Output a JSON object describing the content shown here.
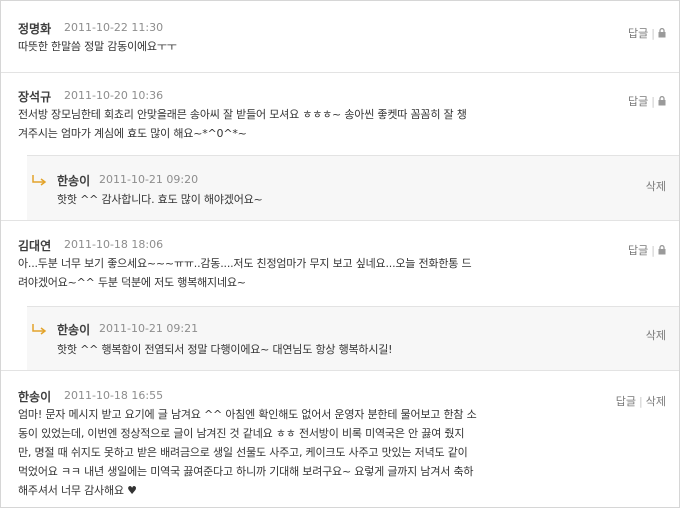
{
  "comments": [
    {
      "author": "정명화",
      "date": "2011-10-22 11:30",
      "lines": [
        "따뜻한 한말씀 정말 감동이에요ㅜㅜ"
      ],
      "actions": [
        "답글"
      ],
      "icon": "lock-icon"
    },
    {
      "author": "장석규",
      "date": "2011-10-20 10:36",
      "lines": [
        "전서방 장모님한테 회쵸리 안맞을래믄 송아씨 잘 받들어 모셔요 ㅎㅎㅎ~ 송아씬 좋켓따 꼼꼼히 잘 챙",
        "겨주시는 엄마가 계심에 효도 많이 해요~*^0^*~"
      ],
      "actions": [
        "답글"
      ],
      "icon": "lock-icon",
      "reply": {
        "author": "한송이",
        "date": "2011-10-21 09:20",
        "lines": [
          "핫핫 ^^ 감사합니다. 효도 많이 해야겠어요~"
        ],
        "action": "삭제"
      }
    },
    {
      "author": "김대연",
      "date": "2011-10-18 18:06",
      "lines": [
        "아...두분 너무 보기 좋으세요~~~ㅠㅠ..감동....저도 친정엄마가 무지 보고 싶네요...오늘 전화한통 드",
        "려야겠어요~^^ 두분 덕분에 저도 행복해지네요~"
      ],
      "actions": [
        "답글"
      ],
      "icon": "lock-icon",
      "reply": {
        "author": "한송이",
        "date": "2011-10-21 09:21",
        "lines": [
          "핫핫 ^^ 행복함이 전염되서 정말 다행이에요~ 대연님도 항상 행복하시길!"
        ],
        "action": "삭제"
      }
    },
    {
      "author": "한송이",
      "date": "2011-10-18 16:55",
      "lines": [
        "엄마! 문자 메시지 받고 요기에 글 남겨요 ^^ 아침엔 확인해도 없어서 운영자 분한테 물어보고 한참 소",
        "동이 있었는데, 이번엔 정상적으로 글이 남겨진 것 같네요 ㅎㅎ 전서방이 비록 미역국은 안 끓여 줬지",
        "만, 명절 때 쉬지도 못하고 받은 배려금으로 생일 선물도 사주고, 케이크도 사주고 맛있는 저녁도 같이",
        "먹었어요 ㅋㅋ 내년 생일에는 미역국 끓여준다고 하니까 기대해 보려구요~ 요렇게 글까지 남겨서 축하",
        "해주셔서 너무 감사해요 ♥"
      ],
      "actions": [
        "답글",
        "삭제"
      ]
    }
  ]
}
